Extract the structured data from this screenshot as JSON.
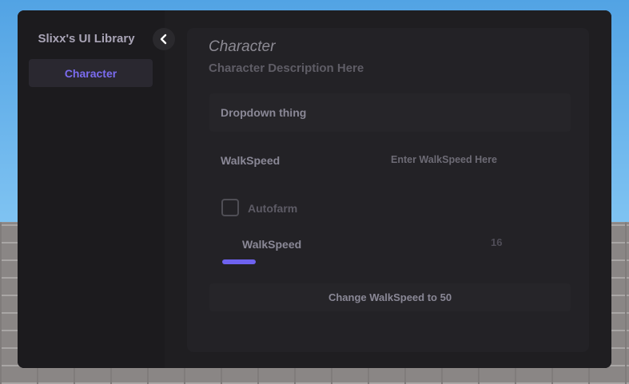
{
  "window": {
    "library_title": "Slixx's UI Library",
    "accent_color": "#6e62ef"
  },
  "sidebar": {
    "tabs": [
      {
        "label": "Character",
        "selected": true
      }
    ],
    "collapse_icon": "chevron-left-icon"
  },
  "section": {
    "title": "Character",
    "description": "Character Description Here",
    "dropdown": {
      "label": "Dropdown thing"
    },
    "textbox": {
      "label": "WalkSpeed",
      "placeholder": "Enter WalkSpeed Here",
      "value": ""
    },
    "toggle": {
      "label": "Autofarm",
      "checked": false
    },
    "slider": {
      "label": "WalkSpeed",
      "value": "16",
      "fill_fraction": 0.14
    },
    "button": {
      "label": "Change WalkSpeed to 50"
    }
  }
}
